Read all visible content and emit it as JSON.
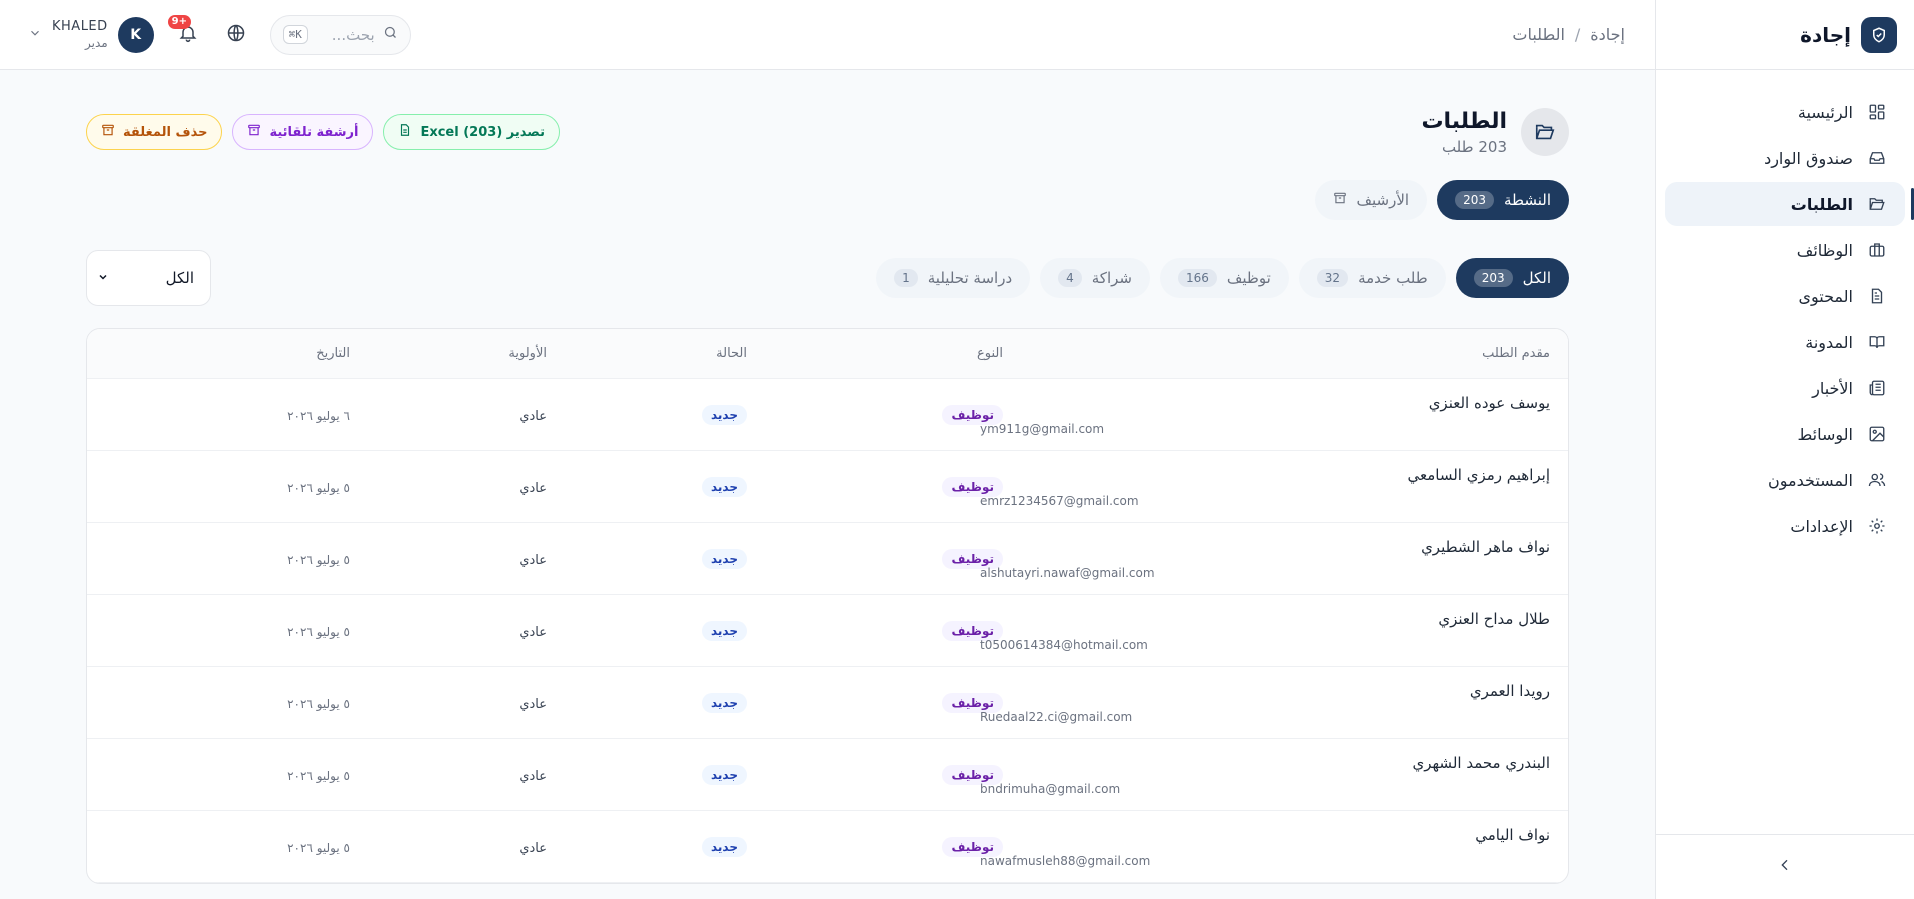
{
  "brand": {
    "name": "إجادة"
  },
  "breadcrumb": {
    "home": "إجادة",
    "separator": "/",
    "current": "الطلبات"
  },
  "user": {
    "name": "KHALED",
    "role": "مدير",
    "initial": "K"
  },
  "notifications": {
    "count": "9+"
  },
  "search": {
    "placeholder": "بحث...",
    "shortcut": "⌘K"
  },
  "sidebar": {
    "items": [
      {
        "label": "الرئيسية",
        "icon": "dashboard-icon"
      },
      {
        "label": "صندوق الوارد",
        "icon": "inbox-icon"
      },
      {
        "label": "الطلبات",
        "icon": "folder-open-icon",
        "active": true
      },
      {
        "label": "الوظائف",
        "icon": "briefcase-icon"
      },
      {
        "label": "المحتوى",
        "icon": "document-icon"
      },
      {
        "label": "المدونة",
        "icon": "book-open-icon"
      },
      {
        "label": "الأخبار",
        "icon": "newspaper-icon"
      },
      {
        "label": "الوسائط",
        "icon": "image-icon"
      },
      {
        "label": "المستخدمون",
        "icon": "users-icon"
      },
      {
        "label": "الإعدادات",
        "icon": "gear-icon"
      }
    ]
  },
  "page": {
    "title": "الطلبات",
    "subtitle": "203 طلب"
  },
  "actions": {
    "delete_closed": "حذف المغلقة",
    "auto_archive": "أرشفة تلقائية",
    "export": "تصدير (203) Excel"
  },
  "tabs": [
    {
      "label": "النشطة",
      "count": "203",
      "active": true
    },
    {
      "label": "الأرشيف",
      "count": ""
    }
  ],
  "filters": [
    {
      "label": "الكل",
      "count": "203",
      "active": true
    },
    {
      "label": "طلب خدمة",
      "count": "32"
    },
    {
      "label": "توظيف",
      "count": "166"
    },
    {
      "label": "شراكة",
      "count": "4"
    },
    {
      "label": "دراسة تحليلية",
      "count": "1"
    }
  ],
  "select": {
    "value": "الكل"
  },
  "table": {
    "columns": {
      "requester": "مقدم الطلب",
      "type": "النوع",
      "status": "الحالة",
      "priority": "الأولوية",
      "date": "التاريخ"
    },
    "rows": [
      {
        "name": "يوسف عوده العنزي",
        "email": "ym911g@gmail.com",
        "type": "توظيف",
        "status": "جديد",
        "priority": "عادي",
        "date": "٦ يوليو ٢٠٢٦"
      },
      {
        "name": "إبراهيم رمزي السامعي",
        "email": "emrz1234567@gmail.com",
        "type": "توظيف",
        "status": "جديد",
        "priority": "عادي",
        "date": "٥ يوليو ٢٠٢٦"
      },
      {
        "name": "نواف ماهر الشطيري",
        "email": "alshutayri.nawaf@gmail.com",
        "type": "توظيف",
        "status": "جديد",
        "priority": "عادي",
        "date": "٥ يوليو ٢٠٢٦"
      },
      {
        "name": "طلال مداح العنزي",
        "email": "t0500614384@hotmail.com",
        "type": "توظيف",
        "status": "جديد",
        "priority": "عادي",
        "date": "٥ يوليو ٢٠٢٦"
      },
      {
        "name": "رويدا العمري",
        "email": "Ruedaal22.ci@gmail.com",
        "type": "توظيف",
        "status": "جديد",
        "priority": "عادي",
        "date": "٥ يوليو ٢٠٢٦"
      },
      {
        "name": "البندري محمد الشهري",
        "email": "bndrimuha@gmail.com",
        "type": "توظيف",
        "status": "جديد",
        "priority": "عادي",
        "date": "٥ يوليو ٢٠٢٦"
      },
      {
        "name": "نواف اليامي",
        "email": "nawafmusleh88@gmail.com",
        "type": "توظيف",
        "status": "جديد",
        "priority": "عادي",
        "date": "٥ يوليو ٢٠٢٦"
      }
    ]
  }
}
